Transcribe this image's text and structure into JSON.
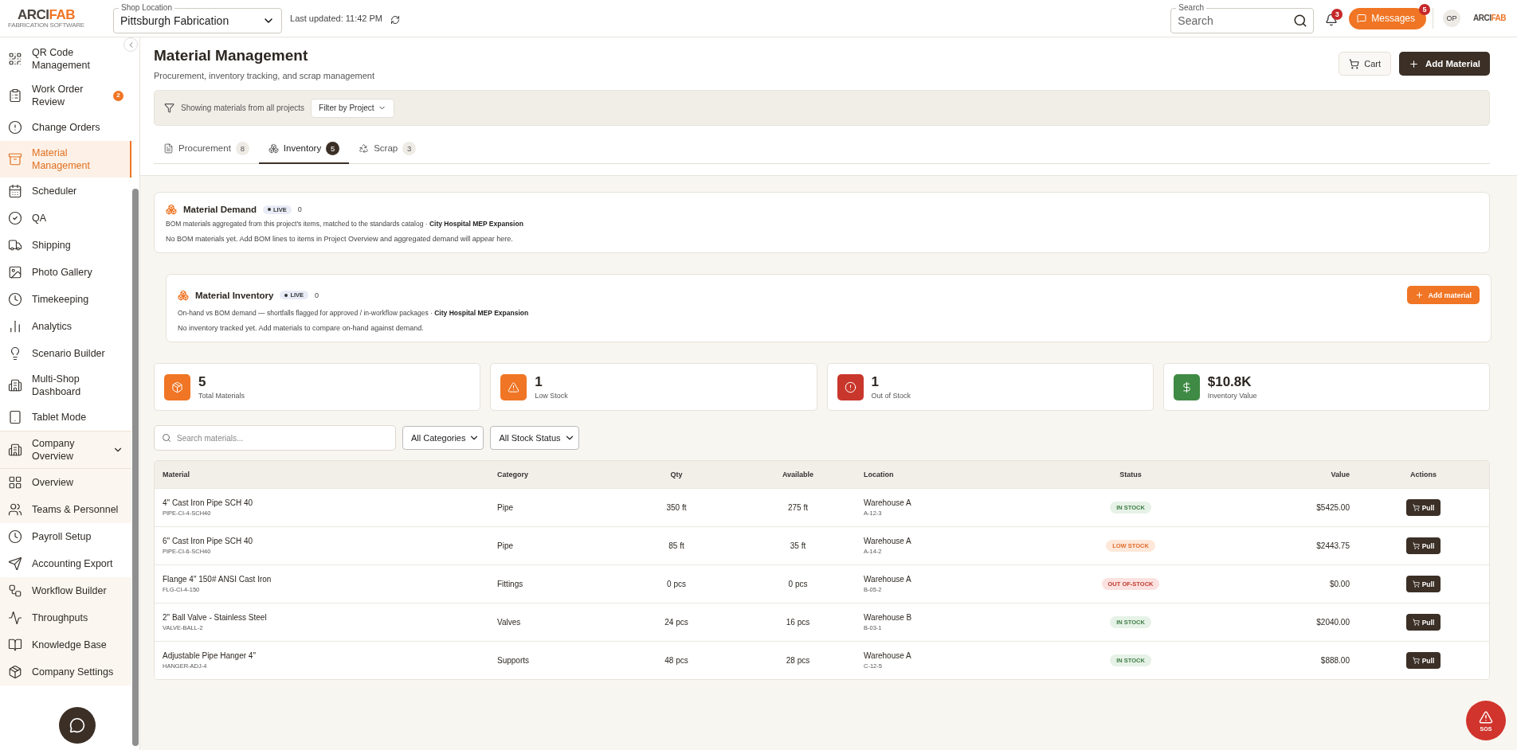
{
  "header": {
    "logo": {
      "prefix": "ARCI",
      "accent": "FAB",
      "tagline": "FABRICATION SOFTWARE"
    },
    "shop_location": {
      "label": "Shop Location",
      "value": "Pittsburgh Fabrication"
    },
    "last_updated": "Last updated: 11:42 PM",
    "search": {
      "label": "Search",
      "placeholder": "Search"
    },
    "notifications_badge": "3",
    "messages": {
      "label": "Messages",
      "badge": "5"
    },
    "avatar": "OP",
    "right_logo": {
      "prefix": "ARCI",
      "accent": "FAB"
    }
  },
  "sidebar": {
    "items": [
      {
        "label": "QR Code Management",
        "selected": false
      },
      {
        "label": "Work Order Review",
        "selected": false,
        "badge": "2"
      },
      {
        "label": "Change Orders",
        "selected": false
      },
      {
        "label": "Material Management",
        "selected": true
      },
      {
        "label": "Scheduler",
        "selected": false
      },
      {
        "label": "QA",
        "selected": false
      },
      {
        "label": "Shipping",
        "selected": false
      },
      {
        "label": "Photo Gallery",
        "selected": false
      },
      {
        "label": "Timekeeping",
        "selected": false
      },
      {
        "label": "Analytics",
        "selected": false
      },
      {
        "label": "Scenario Builder",
        "selected": false
      },
      {
        "label": "Multi-Shop Dashboard",
        "selected": false
      },
      {
        "label": "Tablet Mode",
        "selected": false
      },
      {
        "label": "Company Overview",
        "selected": false,
        "expanded": true,
        "children": [
          {
            "label": "Overview",
            "selected": false,
            "shaded": true
          },
          {
            "label": "Teams & Personnel",
            "selected": false,
            "shaded": true
          },
          {
            "label": "Payroll Setup",
            "selected": false,
            "shaded": false
          },
          {
            "label": "Accounting Export",
            "selected": false,
            "shaded": false
          },
          {
            "label": "Workflow Builder",
            "selected": false,
            "shaded": true
          },
          {
            "label": "Throughputs",
            "selected": false,
            "shaded": true
          },
          {
            "label": "Knowledge Base",
            "selected": false,
            "shaded": true
          },
          {
            "label": "Company Settings",
            "selected": false,
            "shaded": true
          }
        ]
      }
    ]
  },
  "page": {
    "title": "Material Management",
    "subtitle": "Procurement, inventory tracking, and scrap management",
    "cart_button": "Cart",
    "add_button": "Add Material",
    "filter_bar": {
      "text": "Showing materials from all projects",
      "button": "Filter by Project"
    },
    "tabs": [
      {
        "label": "Procurement",
        "count": "8",
        "selected": false
      },
      {
        "label": "Inventory",
        "count": "5",
        "selected": true
      },
      {
        "label": "Scrap",
        "count": "3",
        "selected": false
      }
    ]
  },
  "demand_card": {
    "title": "Material Demand",
    "live": "LIVE",
    "count": "0",
    "description": "BOM materials aggregated from this project's items, matched to the standards catalog · **City Hospital MEP Expansion**",
    "empty": "No BOM materials yet. Add BOM lines to items in Project Overview and aggregated demand will appear here."
  },
  "inventory_card": {
    "title": "Material Inventory",
    "live": "LIVE",
    "count": "0",
    "description": "On-hand vs BOM demand — shortfalls flagged for approved / in-workflow packages · **City Hospital MEP Expansion**",
    "empty": "No inventory tracked yet. Add materials to compare on-hand against demand.",
    "button": "Add material"
  },
  "stats": [
    {
      "value": "5",
      "label": "Total Materials",
      "color": "#f07524"
    },
    {
      "value": "1",
      "label": "Low Stock",
      "color": "#f07524"
    },
    {
      "value": "1",
      "label": "Out of Stock",
      "color": "#c9372c"
    },
    {
      "value": "$10.8K",
      "label": "Inventory Value",
      "color": "#3f8a45"
    }
  ],
  "filters": {
    "search_placeholder": "Search materials...",
    "category": "All Categories",
    "stock_status": "All Stock Status"
  },
  "table": {
    "columns": [
      "Material",
      "Category",
      "Qty",
      "Available",
      "Location",
      "Status",
      "Value",
      "Actions"
    ],
    "rows": [
      {
        "name": "4\" Cast Iron Pipe SCH 40",
        "code": "PIPE-CI-4-SCH40",
        "category": "Pipe",
        "qty": "350 ft",
        "available": "275 ft",
        "location": "Warehouse A",
        "bin": "A-12-3",
        "status": {
          "label": "IN STOCK",
          "kind": "in"
        },
        "value": "$5425.00",
        "action": "Pull"
      },
      {
        "name": "6\" Cast Iron Pipe SCH 40",
        "code": "PIPE-CI-6-SCH40",
        "category": "Pipe",
        "qty": "85 ft",
        "available": "35 ft",
        "location": "Warehouse A",
        "bin": "A-14-2",
        "status": {
          "label": "LOW STOCK",
          "kind": "low"
        },
        "value": "$2443.75",
        "action": "Pull"
      },
      {
        "name": "Flange 4\" 150# ANSI Cast Iron",
        "code": "FLG-CI-4-150",
        "category": "Fittings",
        "qty": "0 pcs",
        "available": "0 pcs",
        "location": "Warehouse A",
        "bin": "B-05-2",
        "status": {
          "label": "OUT OF-STOCK",
          "kind": "out"
        },
        "value": "$0.00",
        "action": "Pull"
      },
      {
        "name": "2\" Ball Valve - Stainless Steel",
        "code": "VALVE-BALL-2",
        "category": "Valves",
        "qty": "24 pcs",
        "available": "16 pcs",
        "location": "Warehouse B",
        "bin": "B-03-1",
        "status": {
          "label": "IN STOCK",
          "kind": "in"
        },
        "value": "$2040.00",
        "action": "Pull"
      },
      {
        "name": "Adjustable Pipe Hanger 4\"",
        "code": "HANGER-ADJ-4",
        "category": "Supports",
        "qty": "48 pcs",
        "available": "28 pcs",
        "location": "Warehouse A",
        "bin": "C-12-5",
        "status": {
          "label": "IN STOCK",
          "kind": "in"
        },
        "value": "$888.00",
        "action": "Pull"
      }
    ]
  },
  "sos_button": "SOS"
}
